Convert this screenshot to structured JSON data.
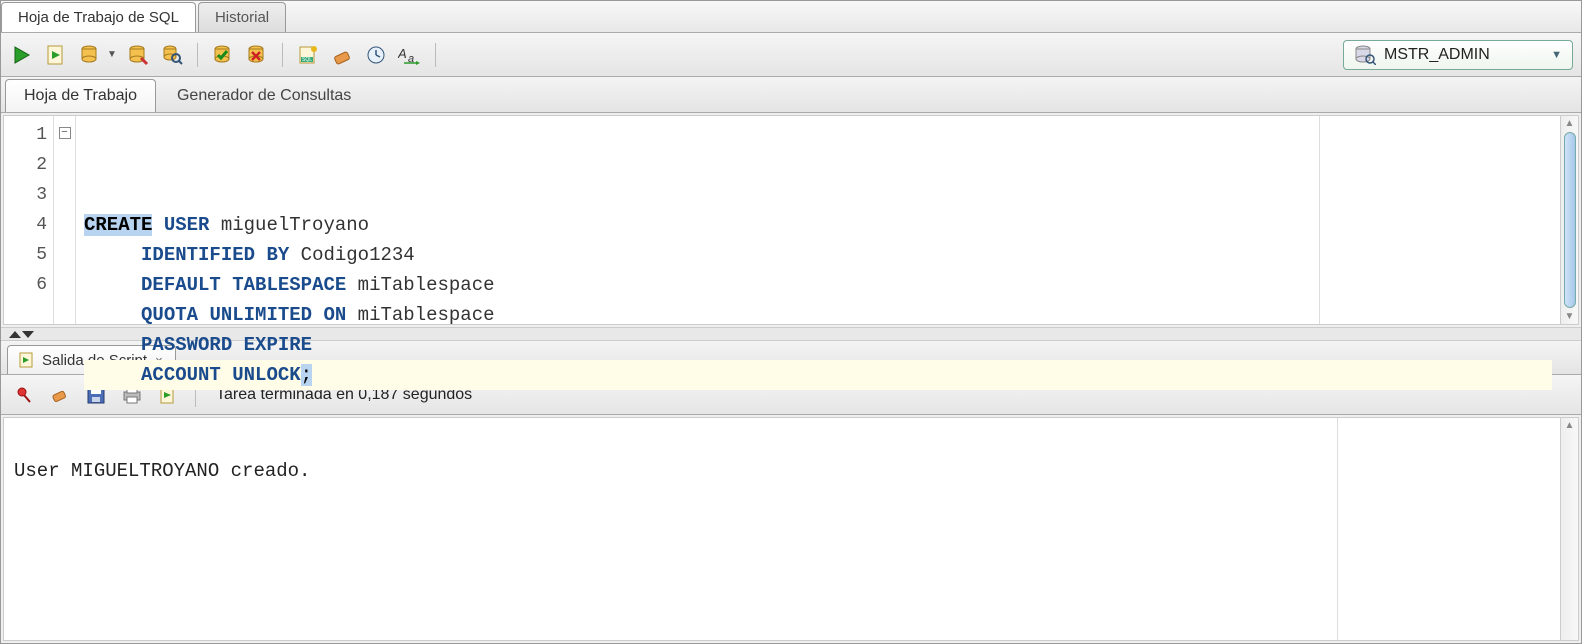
{
  "tabs": {
    "worksheet": "Hoja de Trabajo de SQL",
    "history": "Historial"
  },
  "toolbar": {
    "connection": "MSTR_ADMIN"
  },
  "subtabs": {
    "worksheet": "Hoja de Trabajo",
    "querybuilder": "Generador de Consultas"
  },
  "editor": {
    "line_numbers": [
      "1",
      "2",
      "3",
      "4",
      "5",
      "6"
    ],
    "lines": [
      {
        "tokens": [
          {
            "t": "CREATE",
            "c": "kw-hl"
          },
          {
            "t": " ",
            "c": "txt"
          },
          {
            "t": "USER",
            "c": "kw"
          },
          {
            "t": " miguelTroyano",
            "c": "txt"
          }
        ]
      },
      {
        "tokens": [
          {
            "t": "     ",
            "c": "txt"
          },
          {
            "t": "IDENTIFIED",
            "c": "kw"
          },
          {
            "t": " ",
            "c": "txt"
          },
          {
            "t": "BY",
            "c": "kw"
          },
          {
            "t": " Codigo1234",
            "c": "txt"
          }
        ]
      },
      {
        "tokens": [
          {
            "t": "     ",
            "c": "txt"
          },
          {
            "t": "DEFAULT",
            "c": "kw"
          },
          {
            "t": " ",
            "c": "txt"
          },
          {
            "t": "TABLESPACE",
            "c": "kw"
          },
          {
            "t": " miTablespace",
            "c": "txt"
          }
        ]
      },
      {
        "tokens": [
          {
            "t": "     ",
            "c": "txt"
          },
          {
            "t": "QUOTA",
            "c": "kw"
          },
          {
            "t": " ",
            "c": "txt"
          },
          {
            "t": "UNLIMITED",
            "c": "kw"
          },
          {
            "t": " ",
            "c": "txt"
          },
          {
            "t": "ON",
            "c": "kw"
          },
          {
            "t": " miTablespace",
            "c": "txt"
          }
        ]
      },
      {
        "tokens": [
          {
            "t": "     ",
            "c": "txt"
          },
          {
            "t": "PASSWORD",
            "c": "kw"
          },
          {
            "t": " ",
            "c": "txt"
          },
          {
            "t": "EXPIRE",
            "c": "kw"
          }
        ]
      },
      {
        "tokens": [
          {
            "t": "     ",
            "c": "txt"
          },
          {
            "t": "ACCOUNT",
            "c": "kw"
          },
          {
            "t": " ",
            "c": "txt"
          },
          {
            "t": "UNLOCK",
            "c": "kw"
          },
          {
            "t": ";",
            "c": "cursor-hl"
          }
        ],
        "current": true
      }
    ]
  },
  "output": {
    "tab_label": "Salida de Script",
    "close": "×",
    "status": "Tarea terminada en 0,187 segundos",
    "text": "\nUser MIGUELTROYANO creado.\n"
  },
  "icons": {
    "run": "run-icon",
    "script": "script-icon",
    "commit": "commit-icon",
    "explain": "explain-icon",
    "autotrace": "autotrace-icon",
    "sqltuning": "sqltuning-icon",
    "rollback": "rollback-icon",
    "unshared": "unshared-icon",
    "clear": "clear-icon",
    "history": "history-icon",
    "format": "format-icon",
    "db": "db-icon",
    "pin": "pin-icon",
    "eraser": "eraser-icon",
    "save": "save-icon",
    "print": "print-icon",
    "run2": "run2-icon"
  }
}
